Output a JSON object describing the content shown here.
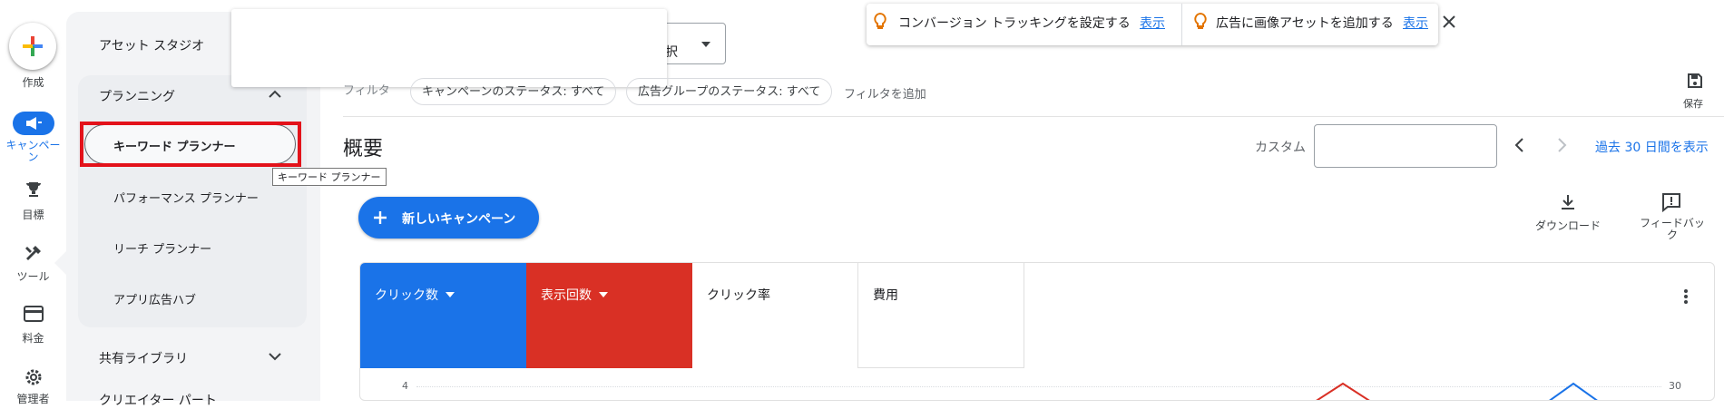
{
  "rail": {
    "create_label": "作成",
    "campaigns_label": "キャンペーン",
    "goals_label": "目標",
    "tools_label": "ツール",
    "billing_label": "料金",
    "admin_label": "管理者"
  },
  "sidebar": {
    "asset_studio": "アセット スタジオ",
    "planning": "プランニング",
    "items": [
      {
        "label": "キーワード プランナー"
      },
      {
        "label": "パフォーマンス プランナー"
      },
      {
        "label": "リーチ プランナー"
      },
      {
        "label": "アプリ広告ハブ"
      }
    ],
    "shared_library": "共有ライブラリ",
    "creator": "クリエイター パート"
  },
  "tooltip": "キーワード プランナー",
  "top": {
    "select_partial": "択",
    "filter_partial": "フィルタ",
    "chips": [
      "キャンペーンのステータス: すべて",
      "広告グループのステータス: すべて"
    ],
    "add_filter": "フィルタを追加",
    "save": "保存"
  },
  "notifications": [
    {
      "text": "コンバージョン トラッキングを設定する",
      "link": "表示"
    },
    {
      "text": "広告に画像アセットを追加する",
      "link": "表示"
    }
  ],
  "overview": {
    "title": "概要",
    "custom": "カスタム",
    "date_link": "過去 30 日間を表示",
    "new_campaign": "新しいキャンペーン",
    "download": "ダウンロード",
    "feedback": "フィードバック"
  },
  "metrics": [
    {
      "label": "クリック数",
      "color": "#1a73e8"
    },
    {
      "label": "表示回数",
      "color": "#d93025"
    },
    {
      "label": "クリック率",
      "color": "#ffffff"
    },
    {
      "label": "費用",
      "color": "#ffffff"
    }
  ],
  "chart": {
    "y_left_max": "4",
    "y_right_max": "30"
  }
}
